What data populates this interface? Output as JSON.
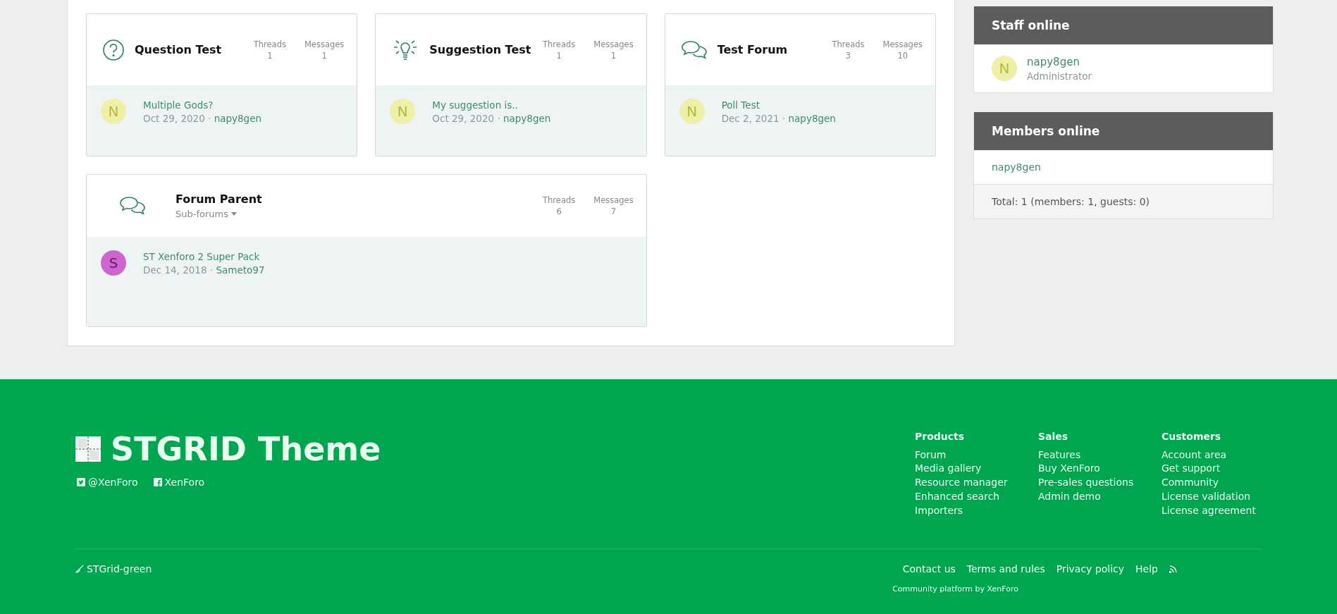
{
  "forums": [
    {
      "kind": "question",
      "title": "Question Test",
      "stats": [
        {
          "label": "Threads",
          "value": "1"
        },
        {
          "label": "Messages",
          "value": "1"
        }
      ],
      "last_post": {
        "initial": "N",
        "color": "#eef0a8",
        "title": "Multiple Gods?",
        "date": "Oct 29, 2020",
        "sep": "·",
        "user": "napy8gen"
      }
    },
    {
      "kind": "bulb",
      "title": "Suggestion Test",
      "stats": [
        {
          "label": "Threads",
          "value": "1"
        },
        {
          "label": "Messages",
          "value": "1"
        }
      ],
      "last_post": {
        "initial": "N",
        "color": "#eef0a8",
        "title": "My suggestion is..",
        "date": "Oct 29, 2020",
        "sep": "·",
        "user": "napy8gen"
      }
    },
    {
      "kind": "chat",
      "title": "Test Forum",
      "stats": [
        {
          "label": "Threads",
          "value": "3"
        },
        {
          "label": "Messages",
          "value": "10"
        }
      ],
      "last_post": {
        "initial": "N",
        "color": "#eef0a8",
        "title": "Poll Test",
        "date": "Dec 2, 2021",
        "sep": "·",
        "user": "napy8gen"
      }
    },
    {
      "kind": "chat",
      "title": "Forum Parent",
      "subforums": "Sub-forums",
      "stats": [
        {
          "label": "Threads",
          "value": "6"
        },
        {
          "label": "Messages",
          "value": "7"
        }
      ],
      "last_post": {
        "initial": "S",
        "color": "#cc66cc",
        "title": "ST Xenforo 2 Super Pack",
        "date": "Dec 14, 2018",
        "sep": "·",
        "user": "Sameto97"
      }
    }
  ],
  "sidebar": {
    "staff_online": {
      "title": "Staff online",
      "members": [
        {
          "initial": "N",
          "color": "#eef0a8",
          "name": "napy8gen",
          "role": "Administrator"
        }
      ]
    },
    "members_online": {
      "title": "Members online",
      "members": [
        "napy8gen"
      ],
      "total": "Total: 1 (members: 1, guests: 0)"
    }
  },
  "footer": {
    "logo": "STGRID Theme",
    "social": [
      {
        "kind": "twitter",
        "label": "@XenForo"
      },
      {
        "kind": "facebook",
        "label": "XenForo"
      }
    ],
    "columns": [
      {
        "title": "Products",
        "links": [
          "Forum",
          "Media gallery",
          "Resource manager",
          "Enhanced search",
          "Importers"
        ]
      },
      {
        "title": "Sales",
        "links": [
          "Features",
          "Buy XenForo",
          "Pre-sales questions",
          "Admin demo"
        ]
      },
      {
        "title": "Customers",
        "links": [
          "Account area",
          "Get support",
          "Community",
          "License validation",
          "License agreement"
        ]
      }
    ],
    "style": "STGrid-green",
    "links": [
      "Contact us",
      "Terms and rules",
      "Privacy policy",
      "Help"
    ],
    "copyright": "Community platform by XenForo"
  }
}
